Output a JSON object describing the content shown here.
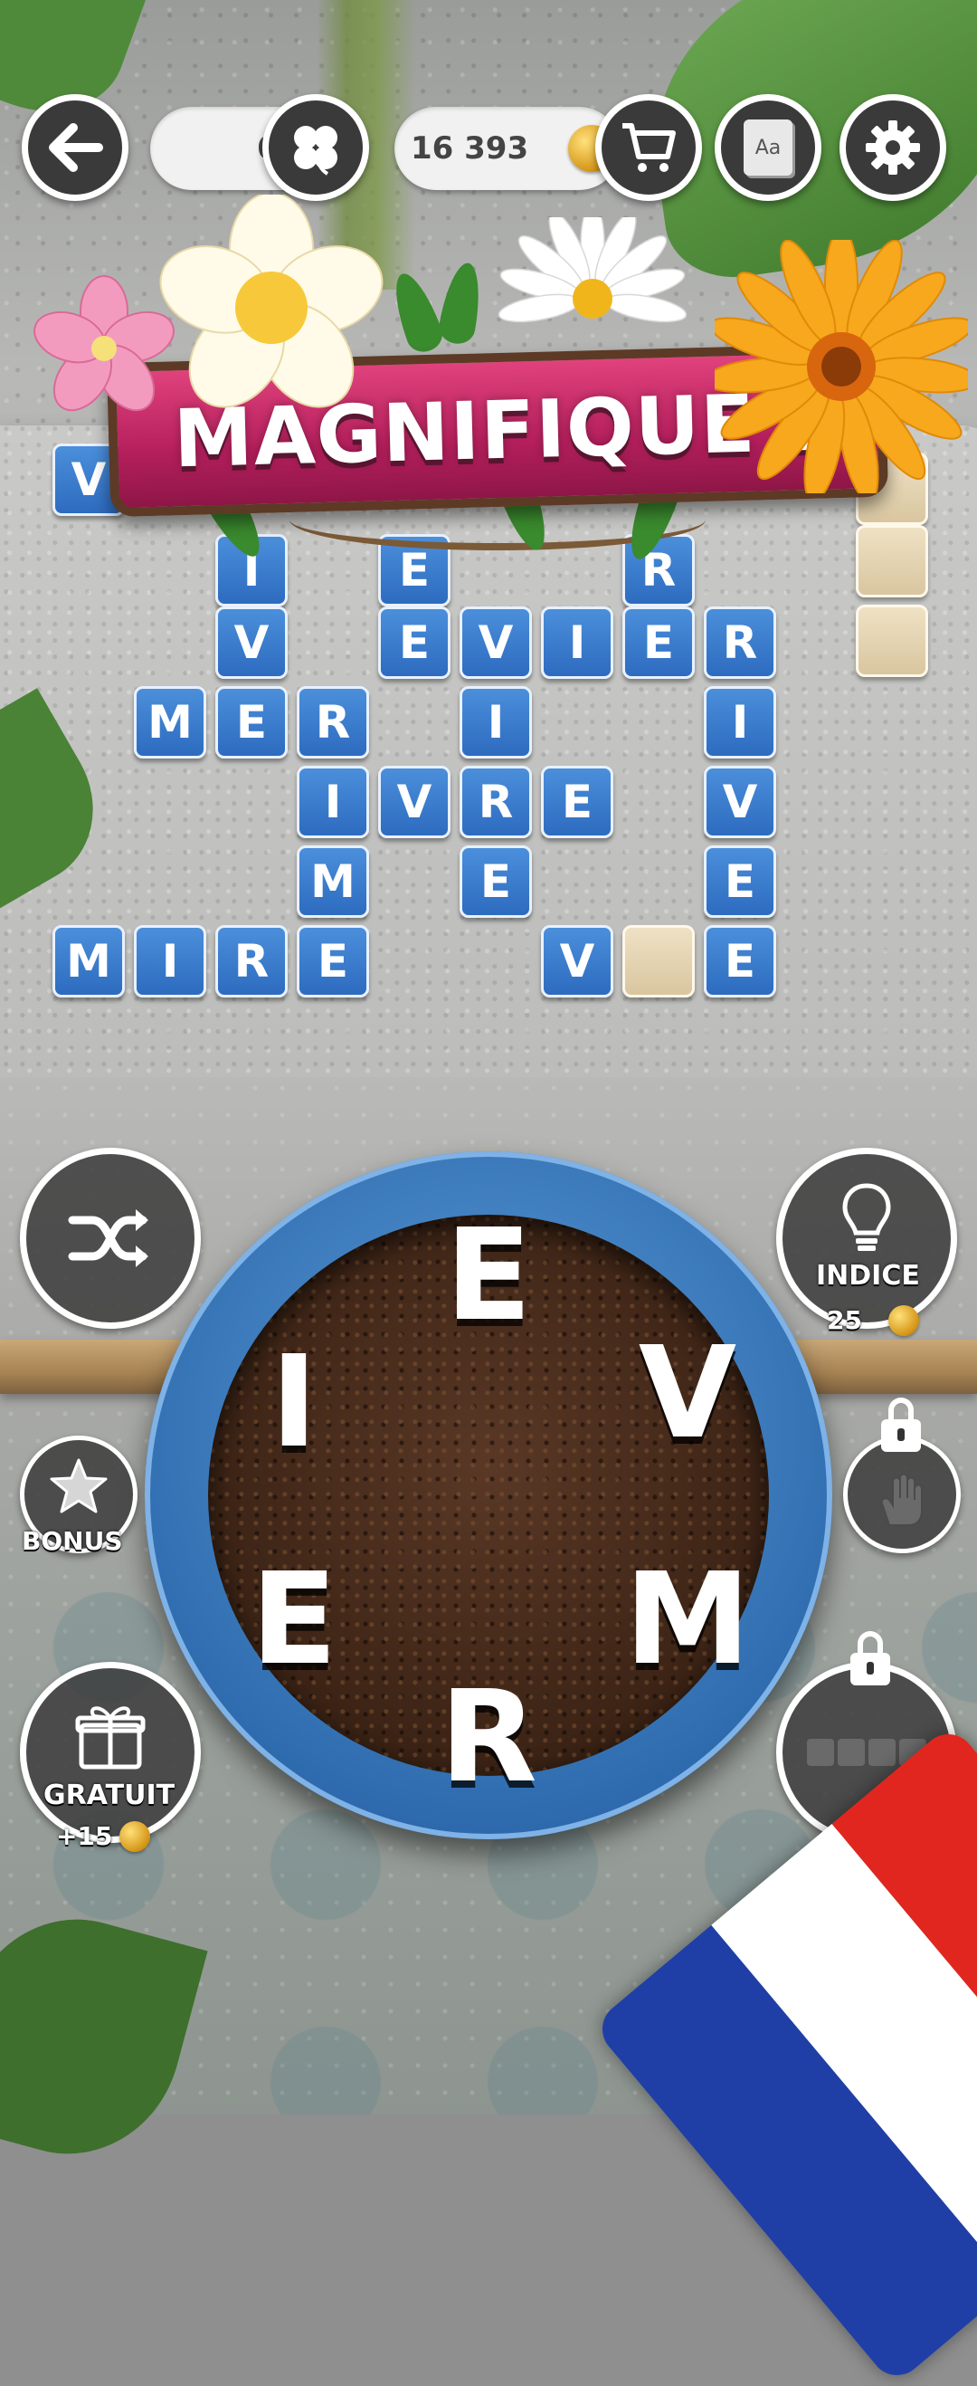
{
  "header": {
    "clover_count": "0",
    "coin_balance": "16 393",
    "icons": {
      "back": "back-arrow-icon",
      "clover": "clover-icon",
      "coin": "coin-icon",
      "shop": "shopping-cart-icon",
      "dictionary": "dictionary-icon",
      "settings": "gear-icon"
    },
    "dictionary_label": "Aa"
  },
  "banner": {
    "text": "MAGNIFIQUE !"
  },
  "grid": {
    "cells": [
      {
        "letter": "V",
        "state": "filled"
      },
      {
        "letter": "I",
        "state": "filled"
      },
      {
        "letter": "E",
        "state": "filled"
      },
      {
        "letter": "R",
        "state": "filled"
      },
      {
        "letter": "V",
        "state": "filled"
      },
      {
        "letter": "E",
        "state": "filled"
      },
      {
        "letter": "V",
        "state": "filled"
      },
      {
        "letter": "I",
        "state": "filled"
      },
      {
        "letter": "E",
        "state": "filled"
      },
      {
        "letter": "R",
        "state": "filled"
      },
      {
        "letter": "M",
        "state": "filled"
      },
      {
        "letter": "E",
        "state": "filled"
      },
      {
        "letter": "R",
        "state": "filled"
      },
      {
        "letter": "I",
        "state": "filled"
      },
      {
        "letter": "I",
        "state": "filled"
      },
      {
        "letter": "I",
        "state": "filled"
      },
      {
        "letter": "V",
        "state": "filled"
      },
      {
        "letter": "R",
        "state": "filled"
      },
      {
        "letter": "E",
        "state": "filled"
      },
      {
        "letter": "V",
        "state": "filled"
      },
      {
        "letter": "M",
        "state": "filled"
      },
      {
        "letter": "E",
        "state": "filled"
      },
      {
        "letter": "E",
        "state": "filled"
      },
      {
        "letter": "M",
        "state": "filled"
      },
      {
        "letter": "I",
        "state": "filled"
      },
      {
        "letter": "R",
        "state": "filled"
      },
      {
        "letter": "E",
        "state": "filled"
      },
      {
        "letter": "V",
        "state": "filled"
      },
      {
        "letter": "",
        "state": "empty"
      },
      {
        "letter": "E",
        "state": "filled"
      },
      {
        "letter": "",
        "state": "empty"
      },
      {
        "letter": "",
        "state": "empty"
      },
      {
        "letter": "",
        "state": "empty"
      }
    ]
  },
  "wheel": {
    "letters": [
      "E",
      "V",
      "M",
      "R",
      "E",
      "I"
    ]
  },
  "buttons": {
    "shuffle_icon": "shuffle-icon",
    "hint_label": "INDICE",
    "hint_cost": "25",
    "hint_icon": "lightbulb-icon",
    "bonus_label": "BONUS",
    "bonus_icon": "star-icon",
    "free_label": "GRATUIT",
    "free_reward": "+15",
    "free_icon": "gift-icon",
    "locked_hand_icon": "hand-icon",
    "locked_word_icon": "word-slots-icon",
    "lock_icon": "lock-icon"
  },
  "colors": {
    "tile_blue": "#2d6bbf",
    "banner_pink": "#b41f5c",
    "pot_blue": "#2f6db0",
    "empty_tile": "#d9c6a0"
  }
}
